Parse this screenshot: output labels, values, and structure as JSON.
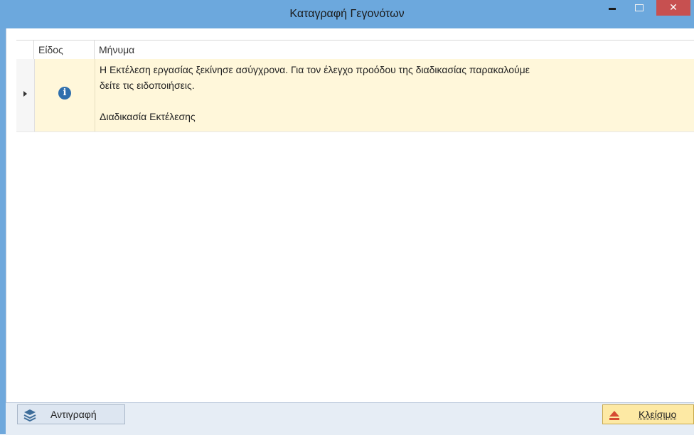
{
  "window": {
    "title": "Καταγραφή Γεγονότων",
    "close_glyph": "✕"
  },
  "grid": {
    "columns": [
      "Είδος",
      "Μήνυμα"
    ],
    "rows": [
      {
        "type_icon": "info-icon",
        "type_glyph": "i",
        "message_lines": [
          "Η Εκτέλεση εργασίας ξεκίνησε ασύγχρονα. Για τον έλεγχο προόδου  της διαδικασίας παρακαλούμε",
          "δείτε τις ειδοποιήσεις.",
          "",
          "Διαδικασία Εκτέλεσης"
        ]
      }
    ]
  },
  "footer": {
    "copy_label": "Αντιγραφή",
    "close_label": "Κλείσιμο"
  },
  "colors": {
    "titlebar": "#6ca8dd",
    "close_button": "#c75050",
    "row_highlight": "#fff7da",
    "close_action": "#fde9a4",
    "info_icon": "#2f6fad"
  }
}
